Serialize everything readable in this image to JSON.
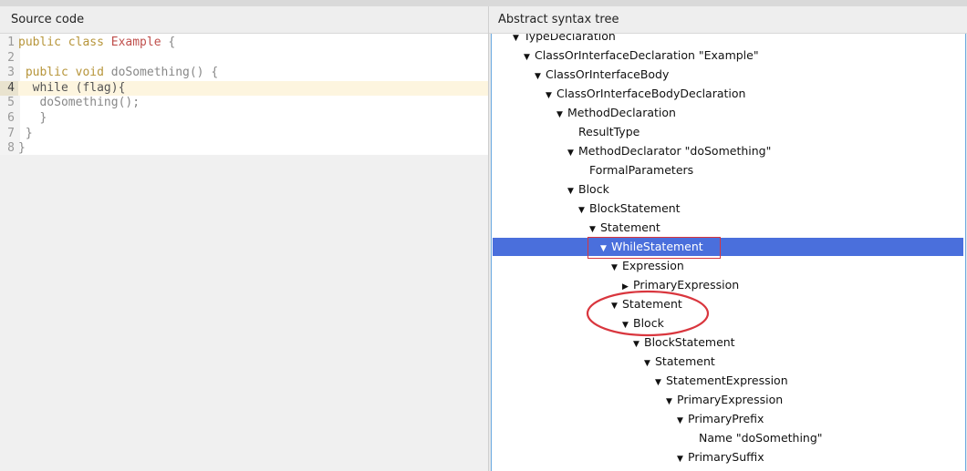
{
  "panels": {
    "source_title": "Source code",
    "ast_title": "Abstract syntax tree"
  },
  "code_lines": [
    {
      "num": "1",
      "parts": [
        {
          "t": "public class ",
          "c": "kw"
        },
        {
          "t": "Example",
          "c": "cls"
        },
        {
          "t": " {",
          "c": ""
        }
      ]
    },
    {
      "num": "2",
      "parts": []
    },
    {
      "num": "3",
      "parts": [
        {
          "t": " public void ",
          "c": "kw"
        },
        {
          "t": "doSomething() {",
          "c": ""
        }
      ]
    },
    {
      "num": "4",
      "parts": [
        {
          "t": "  while",
          "c": "kw"
        },
        {
          "t": " (flag){",
          "c": ""
        }
      ],
      "active": true
    },
    {
      "num": "5",
      "parts": [
        {
          "t": "   doSomething();",
          "c": ""
        }
      ]
    },
    {
      "num": "6",
      "parts": [
        {
          "t": "   }",
          "c": ""
        }
      ]
    },
    {
      "num": "7",
      "parts": [
        {
          "t": " }",
          "c": ""
        }
      ]
    },
    {
      "num": "8",
      "parts": [
        {
          "t": "}",
          "c": ""
        }
      ]
    }
  ],
  "ast_nodes": [
    {
      "label": "TypeDeclaration",
      "depth": 0,
      "expanded": true
    },
    {
      "label": "ClassOrInterfaceDeclaration \"Example\"",
      "depth": 1,
      "expanded": true
    },
    {
      "label": "ClassOrInterfaceBody",
      "depth": 2,
      "expanded": true
    },
    {
      "label": "ClassOrInterfaceBodyDeclaration",
      "depth": 3,
      "expanded": true
    },
    {
      "label": "MethodDeclaration",
      "depth": 4,
      "expanded": true
    },
    {
      "label": "ResultType",
      "depth": 5,
      "leaf": true
    },
    {
      "label": "MethodDeclarator \"doSomething\"",
      "depth": 5,
      "expanded": true
    },
    {
      "label": "FormalParameters",
      "depth": 6,
      "leaf": true
    },
    {
      "label": "Block",
      "depth": 5,
      "expanded": true
    },
    {
      "label": "BlockStatement",
      "depth": 6,
      "expanded": true
    },
    {
      "label": "Statement",
      "depth": 7,
      "expanded": true
    },
    {
      "label": "WhileStatement",
      "depth": 8,
      "expanded": true,
      "selected": true
    },
    {
      "label": "Expression",
      "depth": 9,
      "expanded": true
    },
    {
      "label": "PrimaryExpression",
      "depth": 10,
      "expanded": false
    },
    {
      "label": "Statement",
      "depth": 9,
      "expanded": true
    },
    {
      "label": "Block",
      "depth": 10,
      "expanded": true
    },
    {
      "label": "BlockStatement",
      "depth": 11,
      "expanded": true
    },
    {
      "label": "Statement",
      "depth": 12,
      "expanded": true
    },
    {
      "label": "StatementExpression",
      "depth": 13,
      "expanded": true
    },
    {
      "label": "PrimaryExpression",
      "depth": 14,
      "expanded": true
    },
    {
      "label": "PrimaryPrefix",
      "depth": 15,
      "expanded": true
    },
    {
      "label": "Name \"doSomething\"",
      "depth": 16,
      "leaf": true
    },
    {
      "label": "PrimarySuffix",
      "depth": 15,
      "expanded": true
    }
  ],
  "colors": {
    "selection": "#4a6fdc",
    "annotation_red": "#d9363e"
  }
}
